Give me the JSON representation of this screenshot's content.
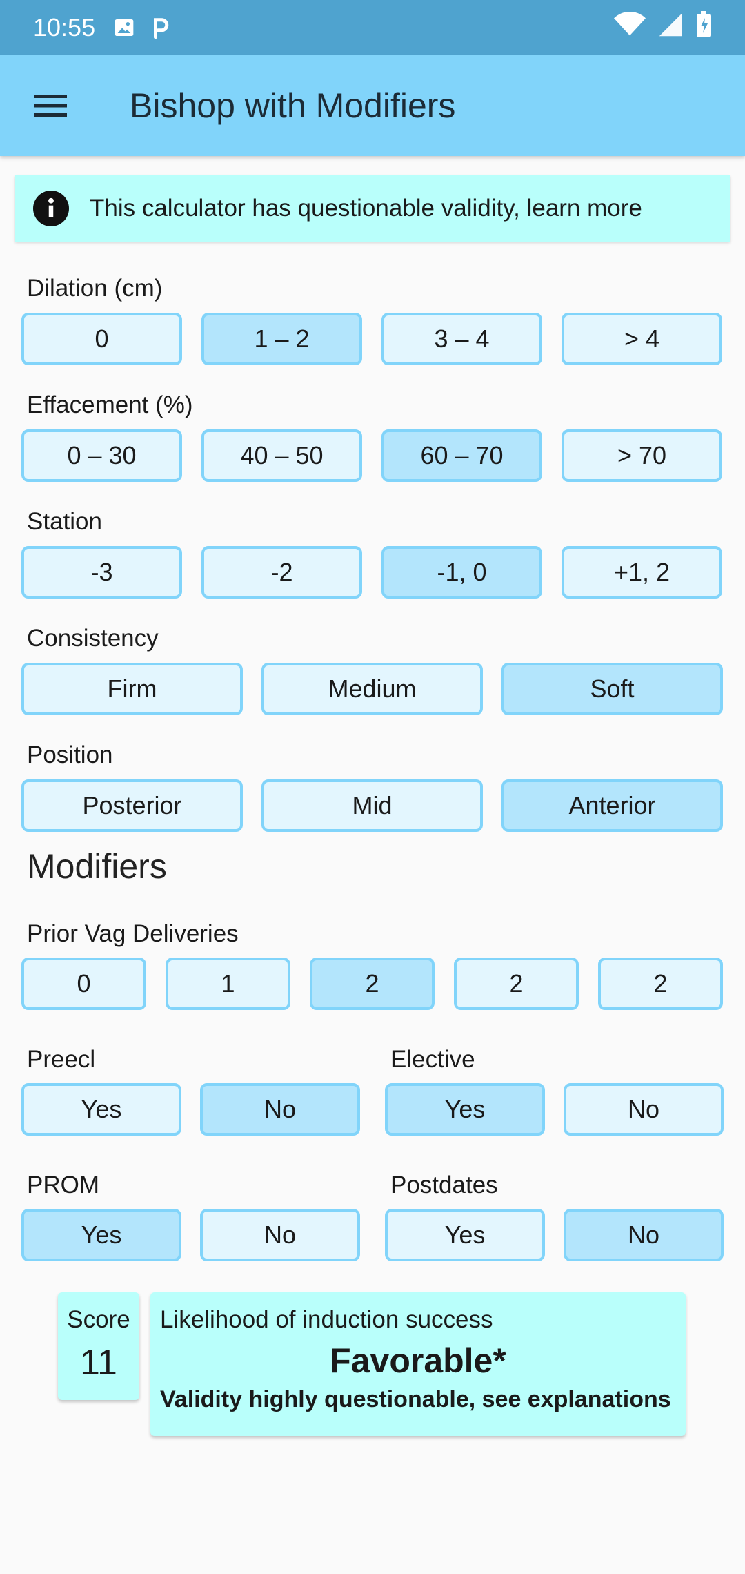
{
  "status_bar": {
    "time": "10:55"
  },
  "app_bar": {
    "title": "Bishop with Modifiers"
  },
  "banner": {
    "text": "This calculator has questionable validity, learn more"
  },
  "dilation": {
    "label": "Dilation (cm)",
    "options": [
      "0",
      "1 – 2",
      "3 – 4",
      "> 4"
    ],
    "selected": "1 – 2"
  },
  "effacement": {
    "label": "Effacement (%)",
    "options": [
      "0 – 30",
      "40 – 50",
      "60 – 70",
      "> 70"
    ],
    "selected": "60 – 70"
  },
  "station": {
    "label": "Station",
    "options": [
      "-3",
      "-2",
      "-1, 0",
      "+1, 2"
    ],
    "selected": "-1, 0"
  },
  "consistency": {
    "label": "Consistency",
    "options": [
      "Firm",
      "Medium",
      "Soft"
    ],
    "selected": "Soft"
  },
  "position": {
    "label": "Position",
    "options": [
      "Posterior",
      "Mid",
      "Anterior"
    ],
    "selected": "Anterior"
  },
  "modifiers": {
    "heading": "Modifiers"
  },
  "prior_vag": {
    "label": "Prior Vag Deliveries",
    "options": [
      "0",
      "1",
      "2",
      "2",
      "2"
    ],
    "selected_index": 2
  },
  "preecl": {
    "label": "Preecl",
    "options": [
      "Yes",
      "No"
    ],
    "selected": "No"
  },
  "elective": {
    "label": "Elective",
    "options": [
      "Yes",
      "No"
    ],
    "selected": "Yes"
  },
  "prom": {
    "label": "PROM",
    "options": [
      "Yes",
      "No"
    ],
    "selected": "Yes"
  },
  "postdates": {
    "label": "Postdates",
    "options": [
      "Yes",
      "No"
    ],
    "selected": "No"
  },
  "score": {
    "label": "Score",
    "value": "11"
  },
  "result": {
    "label": "Likelihood of induction success",
    "value": "Favorable*",
    "note": "Validity highly questionable, see explanations"
  }
}
